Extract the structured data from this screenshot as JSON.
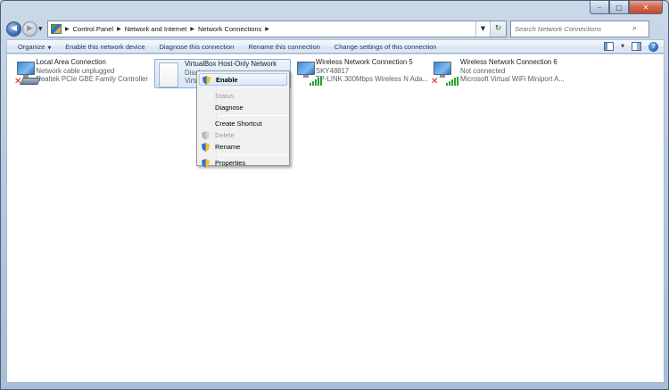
{
  "window": {
    "caption": {
      "minimize": "–",
      "maximize": "□",
      "close": "✕"
    }
  },
  "address_bar": {
    "back_glyph": "◀",
    "forward_glyph": "▶",
    "crumbs": [
      "Control Panel",
      "Network and Internet",
      "Network Connections"
    ],
    "separator": "▶",
    "dropdown_glyph": "▼",
    "refresh_glyph": "↻"
  },
  "search": {
    "placeholder": "Search Network Connections",
    "icon": "search-icon",
    "glyph": "⌕"
  },
  "commandbar": {
    "organize": "Organize",
    "enable": "Enable this network device",
    "diagnose": "Diagnose this connection",
    "rename": "Rename this connection",
    "change_settings": "Change settings of this connection",
    "dropdown_glyph": "▼",
    "help_glyph": "?"
  },
  "connections": [
    {
      "name": "Local Area Connection",
      "status": "Network cable unplugged",
      "device": "Realtek PCIe GBE Family Controller",
      "icon": "wired-network-icon",
      "state": "error"
    },
    {
      "name": "VirtualBox Host-Only Network",
      "status": "Disab",
      "device": "Virtu",
      "icon": "disabled-adapter-icon",
      "state": "disabled"
    },
    {
      "name": "Wireless Network Connection 5",
      "status": "SKY48817",
      "device": "TP-LINK 300Mbps Wireless N Ada...",
      "icon": "wireless-network-icon",
      "state": "connected"
    },
    {
      "name": "Wireless Network Connection 6",
      "status": "Not connected",
      "device": "Microsoft Virtual WiFi Miniport A...",
      "icon": "wireless-network-icon",
      "state": "error"
    }
  ],
  "context_menu": {
    "items": [
      {
        "label": "Enable",
        "bold": true,
        "highlighted": true,
        "disabled": false,
        "icon": "uac-shield-icon"
      },
      {
        "label": "Status",
        "disabled": true
      },
      {
        "label": "Diagnose",
        "disabled": false
      },
      {
        "label": "Create Shortcut",
        "disabled": false
      },
      {
        "label": "Delete",
        "disabled": true,
        "icon": "uac-shield-icon"
      },
      {
        "label": "Rename",
        "disabled": false,
        "icon": "uac-shield-icon"
      },
      {
        "label": "Properties",
        "disabled": false,
        "icon": "uac-shield-icon"
      }
    ]
  },
  "colors": {
    "accent": "#2a62b5",
    "selection": "#d5e7fa",
    "error": "#d0161b",
    "signal": "#27a12f"
  }
}
